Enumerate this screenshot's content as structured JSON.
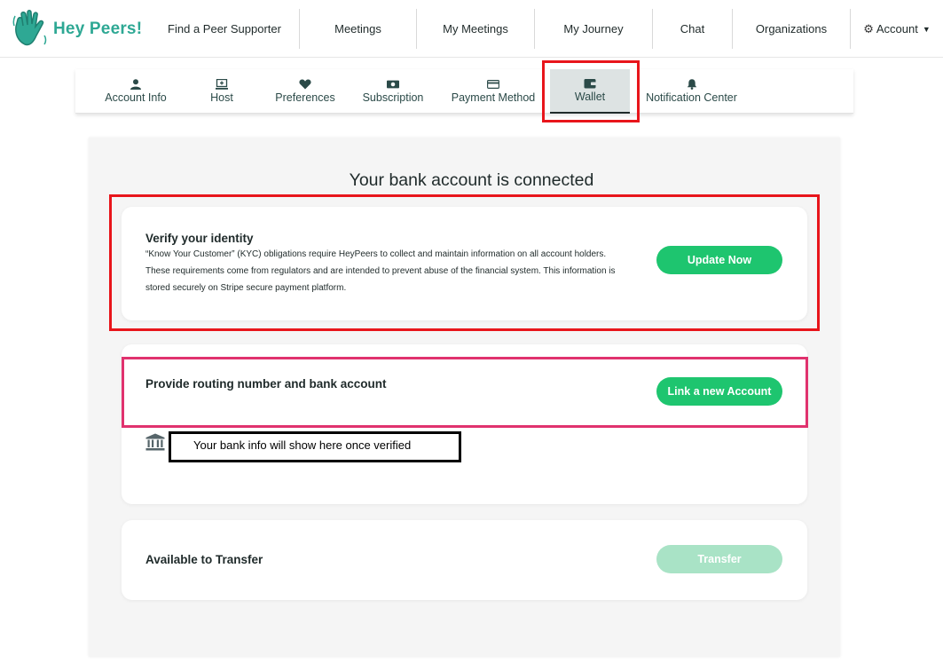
{
  "brand": {
    "name": "Hey Peers!",
    "color": "#2ea894"
  },
  "topnav": {
    "items": [
      {
        "label": "Find a Peer Supporter"
      },
      {
        "label": "Meetings"
      },
      {
        "label": "My Meetings"
      },
      {
        "label": "My Journey"
      },
      {
        "label": "Chat"
      },
      {
        "label": "Organizations"
      }
    ],
    "account_label": "Account"
  },
  "subtabs": {
    "items": [
      {
        "label": "Account Info",
        "icon": "user-icon"
      },
      {
        "label": "Host",
        "icon": "host-icon"
      },
      {
        "label": "Preferences",
        "icon": "heart-icon"
      },
      {
        "label": "Subscription",
        "icon": "money-icon"
      },
      {
        "label": "Payment Method",
        "icon": "credit-card-icon"
      },
      {
        "label": "Wallet",
        "icon": "wallet-icon",
        "active": true
      },
      {
        "label": "Notification Center",
        "icon": "bell-icon"
      }
    ]
  },
  "wallet": {
    "title": "Your bank account is connected",
    "verify": {
      "title": "Verify your identity",
      "description": "“Know Your Customer” (KYC) obligations require HeyPeers to collect and maintain information on all account holders. These requirements come from regulators and are intended to prevent abuse of the financial system. This information is stored securely on Stripe secure payment platform.",
      "button": "Update Now"
    },
    "bank": {
      "title": "Provide routing number and bank account",
      "button": "Link a new Account",
      "info": "Your bank info will show here once verified"
    },
    "transfer": {
      "title": "Available to Transfer",
      "button": "Transfer"
    }
  },
  "colors": {
    "accent_green": "#1ec56f",
    "disabled_green": "#a9e3c6",
    "annotation_red": "#e8151b",
    "annotation_pink": "#e0326e",
    "annotation_black": "#000000"
  }
}
